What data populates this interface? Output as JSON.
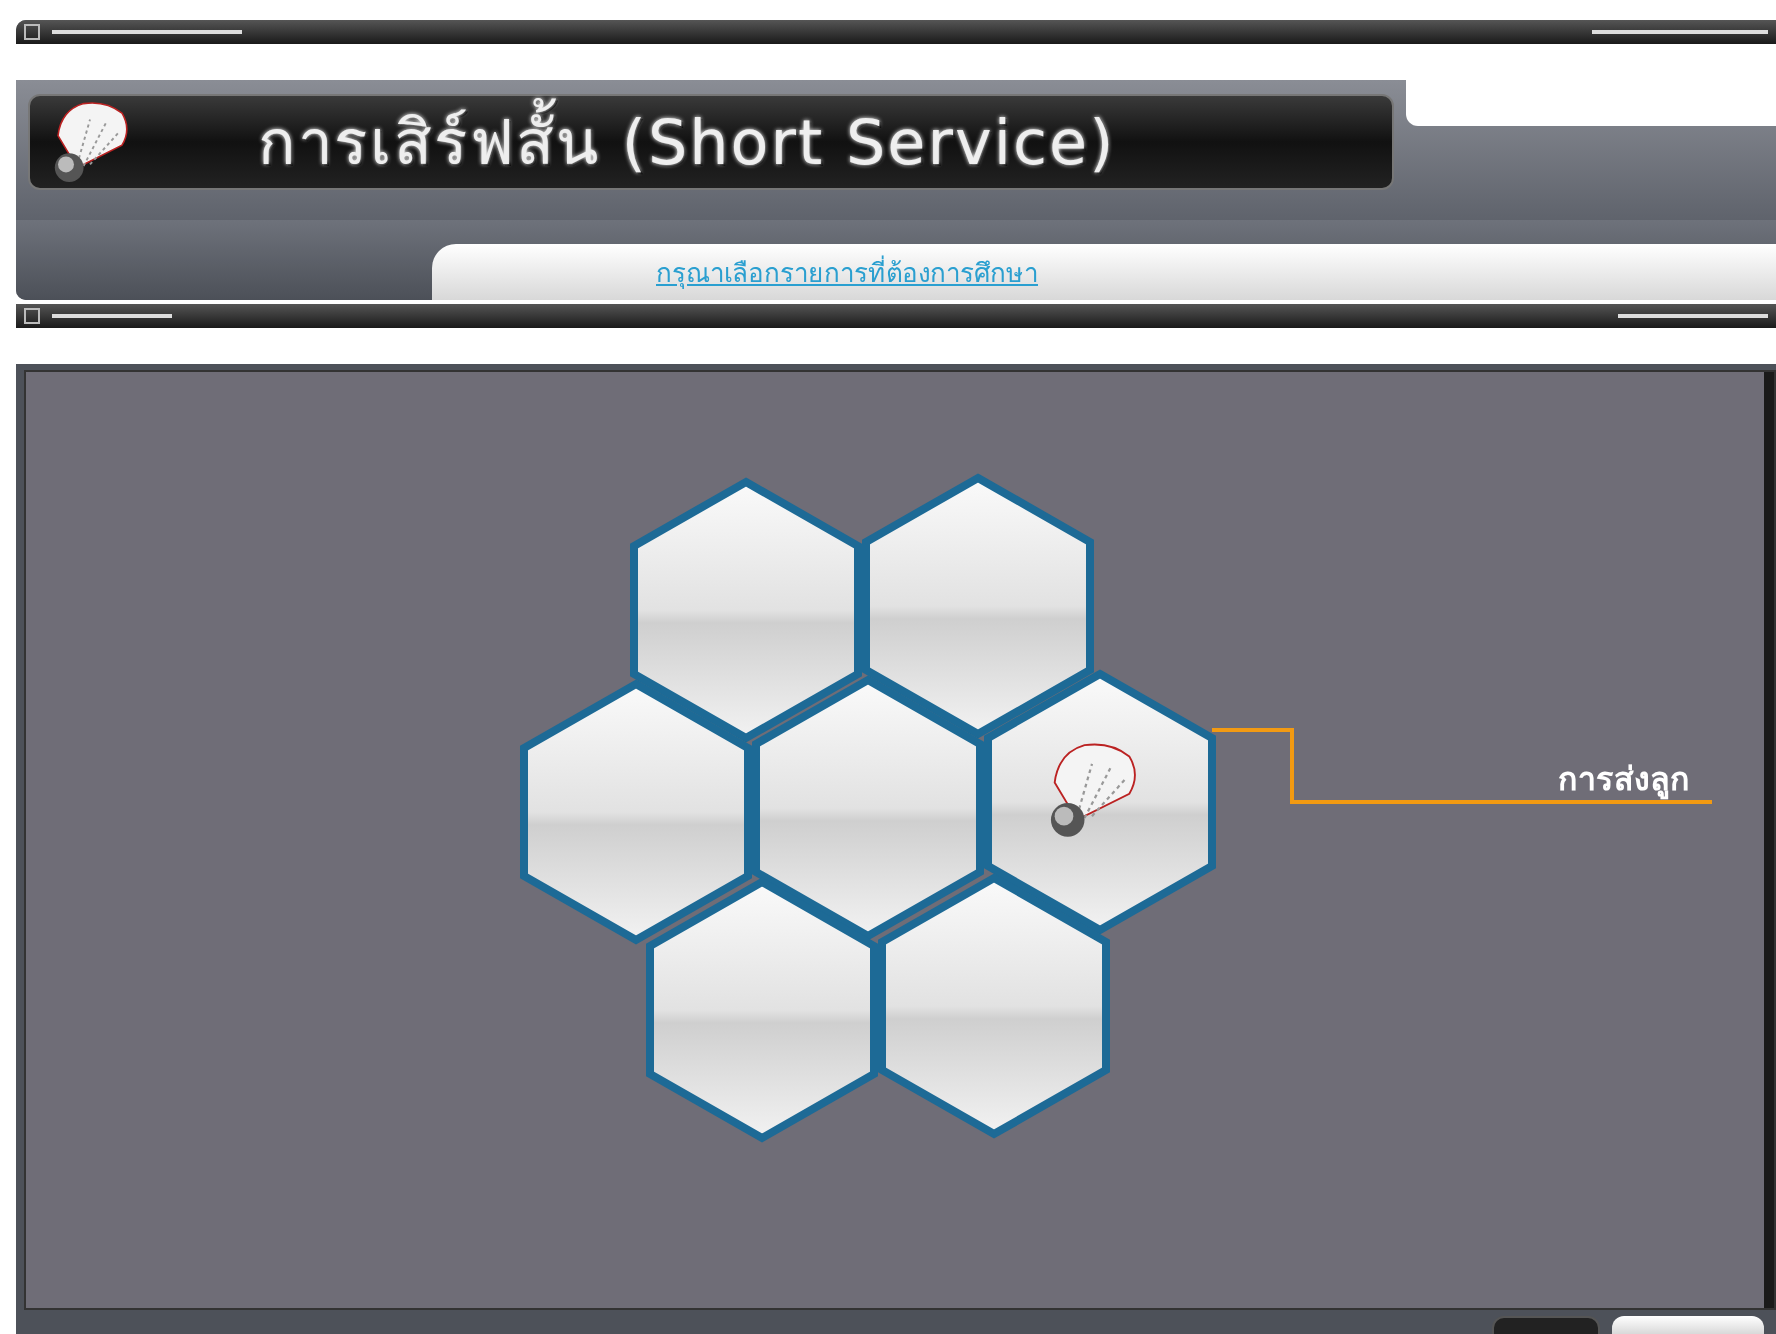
{
  "header": {
    "title": "การเสิร์ฟสั้น (Short Service)",
    "subtitle": "กรุณาเลือกรายการที่ต้องการศึกษา"
  },
  "hex_menu": {
    "cells": [
      {
        "kind": "empty"
      },
      {
        "kind": "empty"
      },
      {
        "kind": "empty"
      },
      {
        "kind": "empty"
      },
      {
        "kind": "shuttlecock",
        "label": "การส่งลูก"
      },
      {
        "kind": "empty"
      },
      {
        "kind": "empty"
      }
    ]
  }
}
